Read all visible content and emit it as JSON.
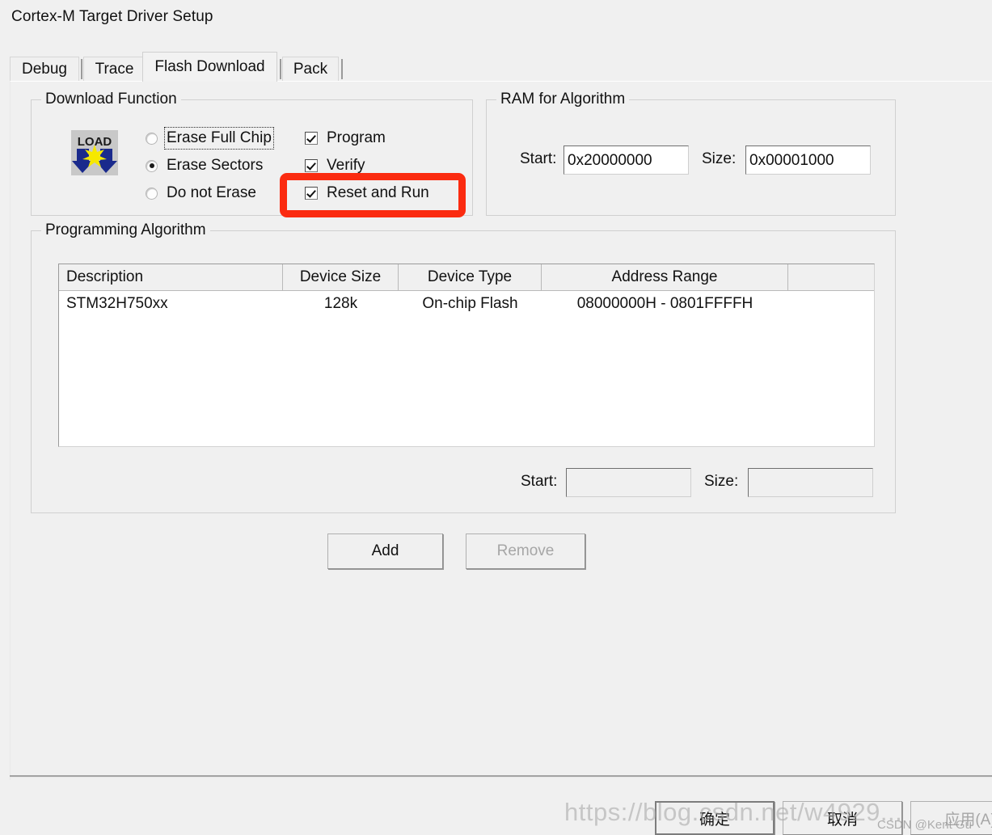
{
  "window": {
    "title": "Cortex-M Target Driver Setup"
  },
  "tabs": [
    {
      "label": "Debug",
      "active": false
    },
    {
      "label": "Trace",
      "active": false
    },
    {
      "label": "Flash Download",
      "active": true
    },
    {
      "label": "Pack",
      "active": false
    }
  ],
  "download_function": {
    "caption": "Download Function",
    "icon": "load-icon",
    "icon_text": "LOAD",
    "erase_mode": "Erase Sectors",
    "radios": [
      {
        "label": "Erase Full Chip",
        "checked": false,
        "focused": true
      },
      {
        "label": "Erase Sectors",
        "checked": true,
        "focused": false
      },
      {
        "label": "Do not Erase",
        "checked": false,
        "focused": false
      }
    ],
    "checkboxes": [
      {
        "label": "Program",
        "checked": true
      },
      {
        "label": "Verify",
        "checked": true
      },
      {
        "label": "Reset and Run",
        "checked": true
      }
    ]
  },
  "ram_for_algorithm": {
    "caption": "RAM for Algorithm",
    "start_label": "Start:",
    "start_value": "0x20000000",
    "size_label": "Size:",
    "size_value": "0x00001000"
  },
  "programming_algorithm": {
    "caption": "Programming Algorithm",
    "columns": [
      "Description",
      "Device Size",
      "Device Type",
      "Address Range",
      ""
    ],
    "rows": [
      {
        "description": "STM32H750xx",
        "device_size": "128k",
        "device_type": "On-chip Flash",
        "address_range": "08000000H - 0801FFFFH"
      }
    ],
    "start_label": "Start:",
    "start_value": "",
    "size_label": "Size:",
    "size_value": ""
  },
  "actions": {
    "add_label": "Add",
    "remove_label": "Remove",
    "remove_enabled": false
  },
  "dialog_buttons": {
    "ok_label": "确定",
    "cancel_label": "取消",
    "apply_label": "应用(A)",
    "apply_enabled": false
  },
  "annotation": {
    "target": "Reset and Run",
    "color": "#fb2b10"
  },
  "watermark": {
    "url": "https://blog.csdn.net/w4929...",
    "user": "CSDN @Kent Gu"
  }
}
